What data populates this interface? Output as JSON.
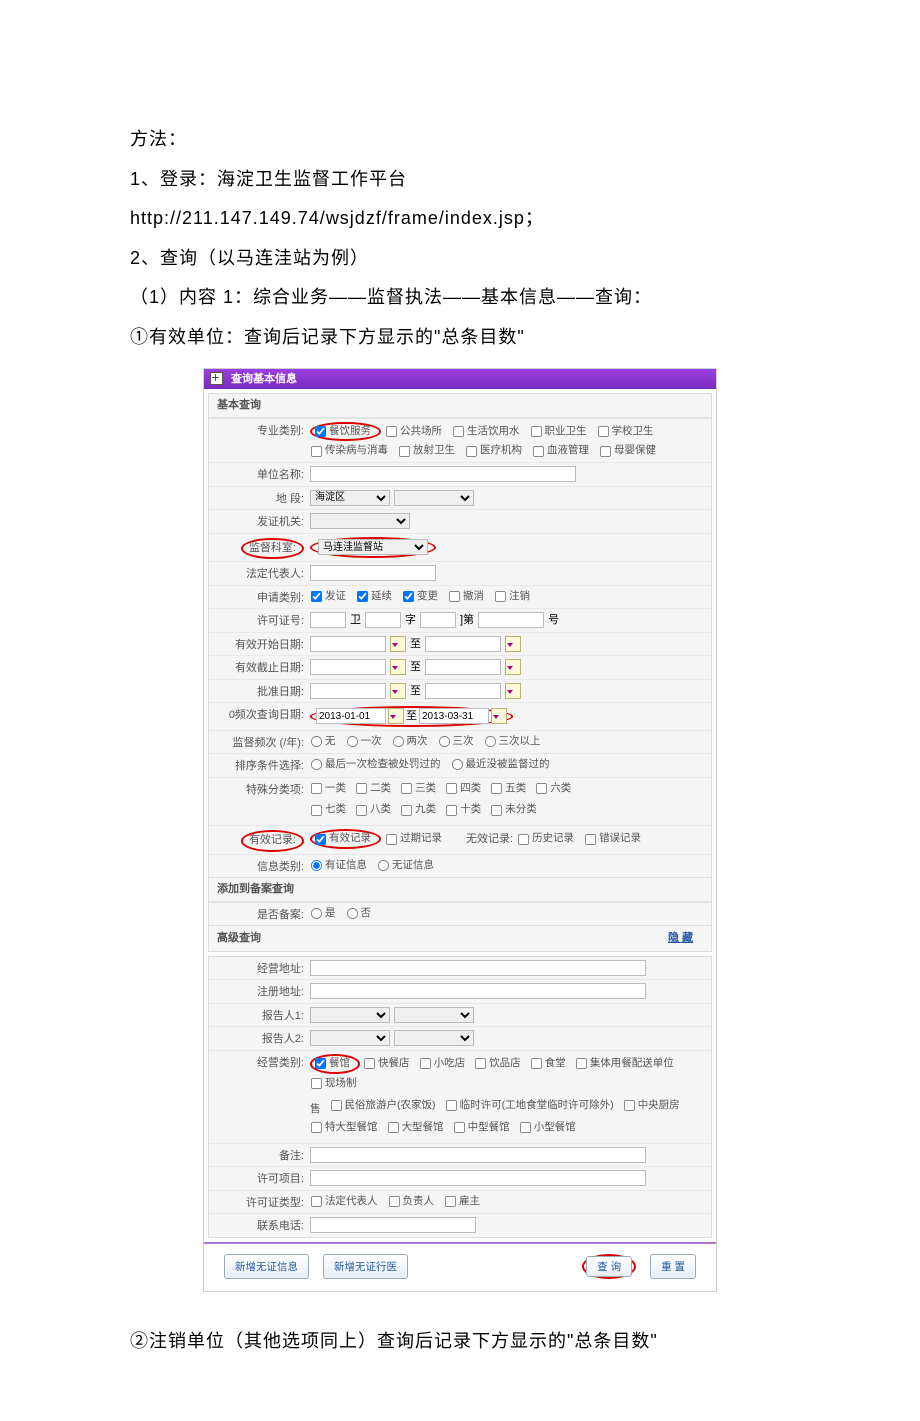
{
  "doc": {
    "heading": "方法：",
    "line1a": "1、登录：海淀卫生监督工作平台",
    "line1b": "http://211.147.149.74/wsjdzf/frame/index.jsp；",
    "line2": "2、查询（以马连洼站为例）",
    "line3": "（1）内容 1：综合业务——监督执法——基本信息——查询：",
    "line4": "①有效单位：查询后记录下方显示的\"总条目数\"",
    "footer": "②注销单位（其他选项同上）查询后记录下方显示的\"总条目数\""
  },
  "ss": {
    "title": "查询基本信息",
    "section_basic": "基本查询",
    "labels": {
      "zylb": "专业类别:",
      "dwmc": "单位名称:",
      "dy": "地 段:",
      "fzjg": "发证机关:",
      "jgks": "监督科室:",
      "fddbr": "法定代表人:",
      "sqlb": "申请类别:",
      "xkzh": "许可证号:",
      "yxks": "有效开始日期:",
      "yxjz": "有效截止日期:",
      "pzrq": "批准日期:",
      "pccx": "0频次查询日期:",
      "jdpc": "监督频次 (/年):",
      "pxtj": "排序条件选择:",
      "tsfl": "特殊分类项:",
      "yxjl": "有效记录:",
      "xxlb": "信息类别:",
      "section_add": "添加到备案查询",
      "sfba": "是否备案:",
      "adv": "高级查询",
      "hide": "隐 藏",
      "jydz": "经营地址:",
      "zcdz": "注册地址:",
      "bgr1": "报告人1:",
      "bgr2": "报告人2:",
      "jylb": "经营类别:",
      "bz": "备注:",
      "xkxm": "许可项目:",
      "xkzlx": "许可证类型:",
      "lxdh": "联系电话:"
    },
    "zylb_opts": [
      "餐饮服务",
      "公共场所",
      "生活饮用水",
      "职业卫生",
      "学校卫生",
      "传染病与消毒",
      "放射卫生",
      "医疗机构",
      "血液管理",
      "母婴保健"
    ],
    "dy_value": "海淀区",
    "jgks_value": "马连洼监督站",
    "sqlb_opts": [
      "发证",
      "延续",
      "变更",
      "撤消",
      "注销"
    ],
    "xkz_parts": [
      "卫",
      "字",
      "]第",
      "号"
    ],
    "date_to": "至",
    "pccx_from": "2013-01-01",
    "pccx_to": "2013-03-31",
    "jdpc_opts": [
      "无",
      "一次",
      "两次",
      "三次",
      "三次以上"
    ],
    "pxtj_opts": [
      "最后一次检查被处罚过的",
      "最近没被监督过的"
    ],
    "tsfl_opts1": [
      "一类",
      "二类",
      "三类",
      "四类",
      "五类",
      "六类"
    ],
    "tsfl_opts2": [
      "七类",
      "八类",
      "九类",
      "十类",
      "未分类"
    ],
    "yxjl_opts": [
      "有效记录",
      "过期记录"
    ],
    "wxjl_label": "无效记录:",
    "wxjl_opts": [
      "历史记录",
      "错误记录"
    ],
    "xxlb_opts": [
      "有证信息",
      "无证信息"
    ],
    "sfba_opts": [
      "是",
      "否"
    ],
    "jylb_row1": [
      "餐馆",
      "快餐店",
      "小吃店",
      "饮品店",
      "食堂",
      "集体用餐配送单位",
      "现场制"
    ],
    "jylb_row2_prefix": "售",
    "jylb_row2": [
      "民俗旅游户(农家饭)",
      "临时许可(工地食堂临时许可除外)",
      "中央厨房"
    ],
    "jylb_row3": [
      "特大型餐馆",
      "大型餐馆",
      "中型餐馆",
      "小型餐馆"
    ],
    "xkzlx_opts": [
      "法定代表人",
      "负责人",
      "雇主"
    ],
    "buttons": {
      "add_wz": "新增无证信息",
      "add_wzxy": "新增无证行医",
      "query": "查 询",
      "reset": "重 置"
    }
  }
}
